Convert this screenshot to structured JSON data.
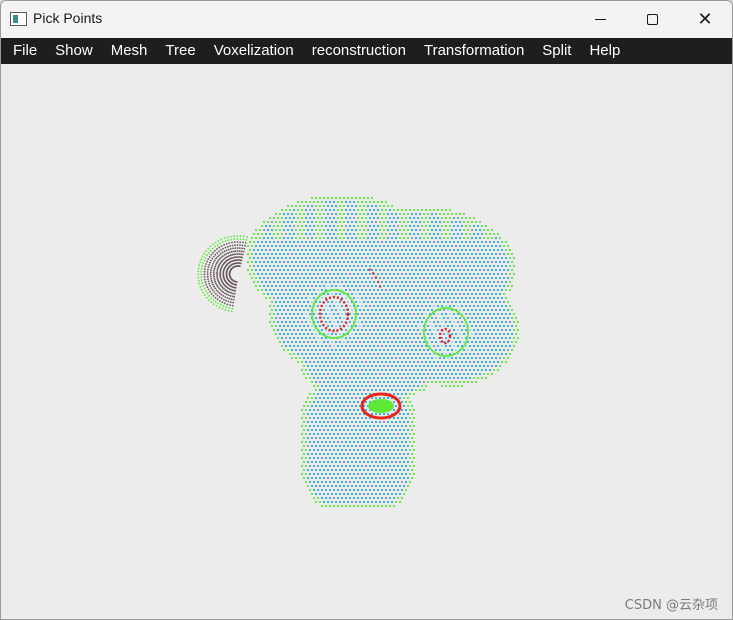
{
  "window": {
    "title": "Pick Points",
    "app_icon": "window-app-icon",
    "controls": {
      "minimize_icon": "minimize-icon",
      "maximize_icon": "maximize-icon",
      "close_glyph": "✕"
    }
  },
  "menubar": {
    "items": [
      {
        "label": "File"
      },
      {
        "label": "Show"
      },
      {
        "label": "Mesh"
      },
      {
        "label": "Tree"
      },
      {
        "label": "Voxelization"
      },
      {
        "label": "reconstruction"
      },
      {
        "label": "Transformation"
      },
      {
        "label": "Split"
      },
      {
        "label": "Help"
      }
    ]
  },
  "viewport": {
    "content": "point-cloud-monkey-head",
    "colors": {
      "outline": "#5ee83a",
      "face": "#29a9e0",
      "selected": "#e8241c",
      "ear": "#6b5a5a",
      "background": "#ececec"
    }
  },
  "watermark": "CSDN @云杂项"
}
